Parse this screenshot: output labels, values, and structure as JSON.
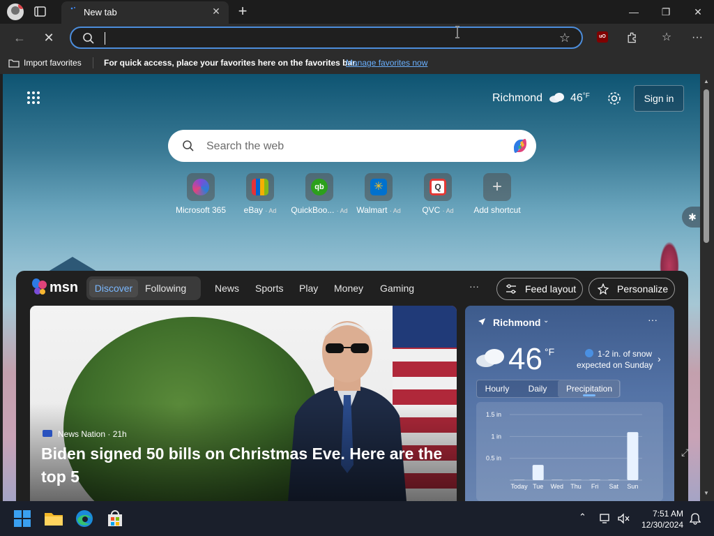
{
  "tab": {
    "title": "New tab"
  },
  "omnibox": {
    "placeholder": "",
    "value": ""
  },
  "favorites_bar": {
    "import_label": "Import favorites",
    "hint": "For quick access, place your favorites here on the favorites bar.",
    "manage_link": "Manage favorites now"
  },
  "ntp": {
    "weather": {
      "city": "Richmond",
      "temp": "46",
      "unit": "°F"
    },
    "signin": "Sign in",
    "search_placeholder": "Search the web",
    "tiles": [
      {
        "label": "Microsoft 365",
        "ad": ""
      },
      {
        "label": "eBay",
        "ad": "· Ad"
      },
      {
        "label": "QuickBoo...",
        "ad": "· Ad"
      },
      {
        "label": "Walmart",
        "ad": "· Ad"
      },
      {
        "label": "QVC",
        "ad": "· Ad"
      },
      {
        "label": "Add shortcut",
        "ad": ""
      }
    ]
  },
  "feed": {
    "logo": "msn",
    "discover": "Discover",
    "following": "Following",
    "nav": [
      "News",
      "Sports",
      "Play",
      "Money",
      "Gaming"
    ],
    "more": "···",
    "feed_layout": "Feed layout",
    "personalize": "Personalize",
    "hero": {
      "source": "News Nation · 21h",
      "headline": "Biden signed 50 bills on Christmas Eve. Here are the top 5"
    },
    "weather_card": {
      "location": "Richmond",
      "more": "···",
      "temp": "46",
      "unit": "°F",
      "snow_line1": "1-2 in. of snow",
      "snow_line2": "expected on Sunday",
      "tabs": [
        "Hourly",
        "Daily",
        "Precipitation"
      ],
      "active_tab": "Precipitation"
    }
  },
  "chart_data": {
    "type": "bar",
    "categories": [
      "Today",
      "Tue",
      "Wed",
      "Thu",
      "Fri",
      "Sat",
      "Sun"
    ],
    "values": [
      0,
      0.35,
      0,
      0,
      0,
      0,
      1.1
    ],
    "yticks": [
      "0.5 in",
      "1 in",
      "1.5 in"
    ],
    "ytick_values": [
      0.5,
      1,
      1.5
    ],
    "ylim": [
      0,
      1.5
    ],
    "title": "",
    "xlabel": "",
    "ylabel": ""
  },
  "taskbar": {
    "time": "7:51 AM",
    "date": "12/30/2024"
  },
  "colors": {
    "accent": "#4c8ddb",
    "link": "#6ab0ff",
    "discover": "#7ab8ff"
  }
}
